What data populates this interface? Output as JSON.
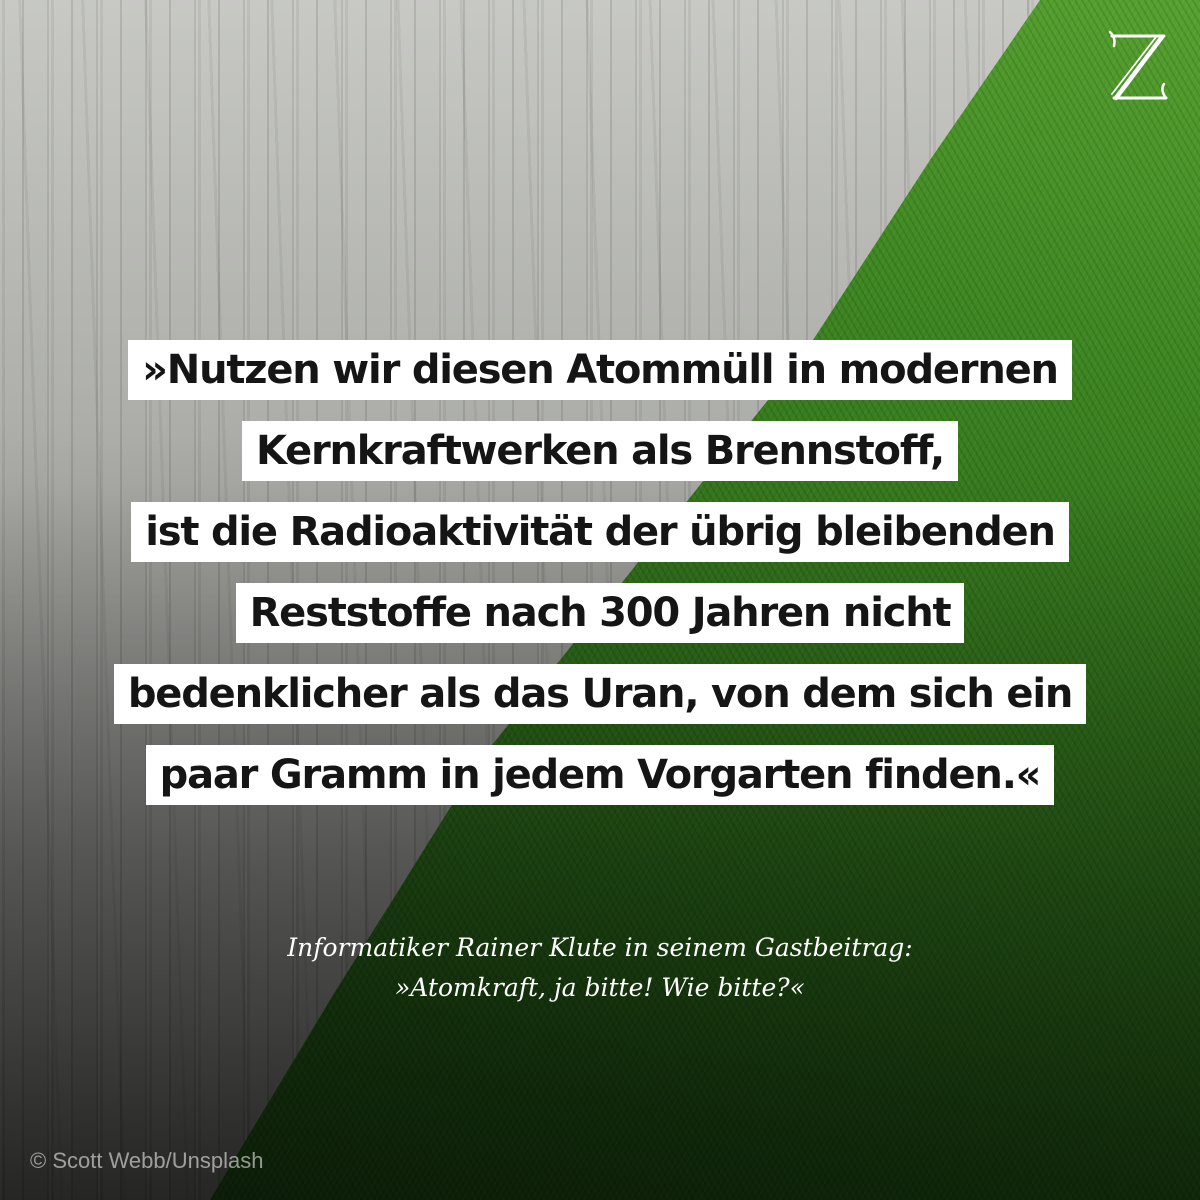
{
  "logo": {
    "letter": "Z",
    "icon": "zeit-z-logo"
  },
  "quote": {
    "lines": [
      "»Nutzen wir diesen Atommüll in modernen",
      "Kernkraftwerken als Brennstoff,",
      "ist die Radioaktivität der übrig bleibenden",
      "Reststoffe nach 300 Jahren nicht",
      "bedenklicher als das Uran, von dem sich ein",
      "paar Gramm in jedem Vorgarten finden.«"
    ]
  },
  "caption": {
    "line1": "Informatiker Rainer Klute in seinem Gastbeitrag:",
    "line2": "»Atomkraft, ja bitte! Wie bitte?«"
  },
  "credit": "© Scott Webb/Unsplash",
  "colors": {
    "quote_bg": "#ffffff",
    "quote_text": "#151515",
    "grass": "#3f8a22",
    "concrete": "#b4b5b0"
  }
}
